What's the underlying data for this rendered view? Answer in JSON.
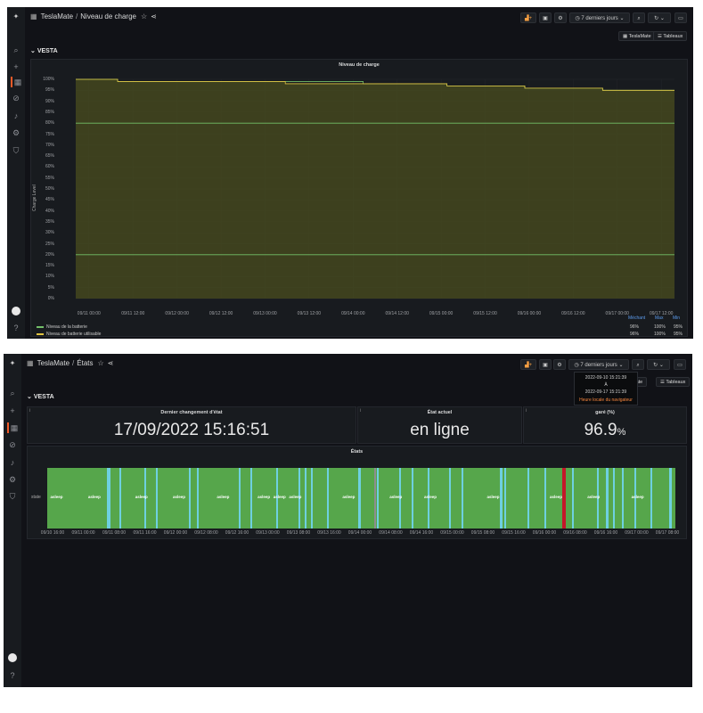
{
  "top": {
    "breadcrumb": {
      "app": "TeslaMate",
      "separator": "/",
      "page": "Niveau de charge"
    },
    "time_range": "7 derniers jours",
    "links": [
      "TeslaMate",
      "Tableaux"
    ],
    "row_title": "VESTA",
    "panel_title": "Niveau de charge",
    "chart_data": {
      "type": "line",
      "title": "Niveau de charge",
      "ylabel": "Charge Level",
      "ylim": [
        0,
        100
      ],
      "y_ticks": [
        "0%",
        "5%",
        "10%",
        "15%",
        "20%",
        "25%",
        "30%",
        "35%",
        "40%",
        "45%",
        "50%",
        "55%",
        "60%",
        "65%",
        "70%",
        "75%",
        "80%",
        "85%",
        "90%",
        "95%",
        "100%"
      ],
      "x_ticks": [
        "09/11 00:00",
        "09/11 12:00",
        "09/12 00:00",
        "09/12 12:00",
        "09/13 00:00",
        "09/13 12:00",
        "09/14 00:00",
        "09/14 12:00",
        "09/15 00:00",
        "09/15 12:00",
        "09/16 00:00",
        "09/16 12:00",
        "09/17 00:00",
        "09/17 12:00"
      ],
      "threshold_lines": [
        80,
        20
      ],
      "series": [
        {
          "name": "Niveau de la batterie",
          "color": "#73bf69",
          "steps": [
            [
              0.0,
              100
            ],
            [
              0.07,
              99
            ],
            [
              0.35,
              99
            ],
            [
              0.48,
              98
            ],
            [
              0.62,
              97
            ],
            [
              0.75,
              96
            ],
            [
              0.88,
              95
            ],
            [
              1.0,
              95
            ]
          ]
        },
        {
          "name": "Niveau de batterie utilisable",
          "color": "#e0c341",
          "steps": [
            [
              0.0,
              100
            ],
            [
              0.07,
              99
            ],
            [
              0.35,
              98
            ],
            [
              0.48,
              98
            ],
            [
              0.62,
              97
            ],
            [
              0.75,
              96
            ],
            [
              0.88,
              95
            ],
            [
              1.0,
              95
            ]
          ]
        }
      ],
      "legend": {
        "headers": [
          "Méchant",
          "Max",
          "Min"
        ],
        "rows": [
          {
            "name": "Niveau de la batterie",
            "values": [
              "96%",
              "100%",
              "95%"
            ]
          },
          {
            "name": "Niveau de batterie utilisable",
            "values": [
              "96%",
              "100%",
              "95%"
            ]
          }
        ]
      }
    }
  },
  "bottom": {
    "breadcrumb": {
      "app": "TeslaMate",
      "separator": "/",
      "page": "États"
    },
    "time_range": "7 derniers jours",
    "links": [
      "TeslaMate",
      "Tableaux"
    ],
    "links_partial": "Mate",
    "row_title": "VESTA",
    "tooltip": {
      "from": "2022-09-10 15:21:39",
      "to_word": "À",
      "to": "2022-09-17 15:21:39",
      "note": "Heure locale du navigateur"
    },
    "stats": [
      {
        "title": "Dernier changement d'état",
        "value": "17/09/2022 15:16:51",
        "unit": ""
      },
      {
        "title": "État actuel",
        "value": "en ligne",
        "unit": ""
      },
      {
        "title": "garé (%)",
        "value": "96.9",
        "unit": "%"
      }
    ],
    "states_panel_title": "États",
    "chart_data": {
      "type": "heatmap",
      "title": "États",
      "row_label": "state",
      "colors": {
        "asleep": "#56a64b",
        "online": "#6ed0e0",
        "charging": "#c4162a",
        "offline": "#8e8e8e"
      },
      "x_ticks": [
        "09/10 16:00",
        "09/11 00:00",
        "09/11 08:00",
        "09/11 16:00",
        "09/12 00:00",
        "09/12 08:00",
        "09/12 16:00",
        "09/13 00:00",
        "09/13 08:00",
        "09/13 16:00",
        "09/14 00:00",
        "09/14 08:00",
        "09/14 16:00",
        "09/15 00:00",
        "09/15 08:00",
        "09/15 16:00",
        "09/16 00:00",
        "09/16 08:00",
        "09/16 16:00",
        "09/17 00:00",
        "09/17 08:00"
      ],
      "label_text": "asleep",
      "marks": [
        {
          "x": 0.095,
          "w": 0.006,
          "state": "online"
        },
        {
          "x": 0.097,
          "w": 0.004,
          "state": "online"
        },
        {
          "x": 0.115,
          "w": 0.003,
          "state": "online"
        },
        {
          "x": 0.155,
          "w": 0.003,
          "state": "online"
        },
        {
          "x": 0.173,
          "w": 0.003,
          "state": "online"
        },
        {
          "x": 0.225,
          "w": 0.003,
          "state": "online"
        },
        {
          "x": 0.238,
          "w": 0.003,
          "state": "online"
        },
        {
          "x": 0.305,
          "w": 0.003,
          "state": "online"
        },
        {
          "x": 0.323,
          "w": 0.003,
          "state": "online"
        },
        {
          "x": 0.365,
          "w": 0.003,
          "state": "online"
        },
        {
          "x": 0.4,
          "w": 0.003,
          "state": "online"
        },
        {
          "x": 0.41,
          "w": 0.003,
          "state": "online"
        },
        {
          "x": 0.42,
          "w": 0.003,
          "state": "online"
        },
        {
          "x": 0.445,
          "w": 0.003,
          "state": "online"
        },
        {
          "x": 0.495,
          "w": 0.004,
          "state": "online"
        },
        {
          "x": 0.52,
          "w": 0.003,
          "state": "offline"
        },
        {
          "x": 0.525,
          "w": 0.003,
          "state": "online"
        },
        {
          "x": 0.56,
          "w": 0.003,
          "state": "online"
        },
        {
          "x": 0.58,
          "w": 0.003,
          "state": "online"
        },
        {
          "x": 0.605,
          "w": 0.003,
          "state": "online"
        },
        {
          "x": 0.64,
          "w": 0.003,
          "state": "online"
        },
        {
          "x": 0.66,
          "w": 0.003,
          "state": "online"
        },
        {
          "x": 0.72,
          "w": 0.005,
          "state": "online"
        },
        {
          "x": 0.728,
          "w": 0.003,
          "state": "online"
        },
        {
          "x": 0.765,
          "w": 0.003,
          "state": "online"
        },
        {
          "x": 0.792,
          "w": 0.003,
          "state": "online"
        },
        {
          "x": 0.82,
          "w": 0.006,
          "state": "charging"
        },
        {
          "x": 0.835,
          "w": 0.003,
          "state": "online"
        },
        {
          "x": 0.875,
          "w": 0.003,
          "state": "online"
        },
        {
          "x": 0.89,
          "w": 0.003,
          "state": "online"
        },
        {
          "x": 0.9,
          "w": 0.003,
          "state": "online"
        },
        {
          "x": 0.915,
          "w": 0.003,
          "state": "online"
        },
        {
          "x": 0.935,
          "w": 0.003,
          "state": "online"
        },
        {
          "x": 0.96,
          "w": 0.003,
          "state": "online"
        },
        {
          "x": 0.99,
          "w": 0.004,
          "state": "online"
        }
      ],
      "labels_at": [
        0.005,
        0.065,
        0.14,
        0.2,
        0.27,
        0.335,
        0.36,
        0.385,
        0.47,
        0.545,
        0.6,
        0.7,
        0.8,
        0.86,
        0.93
      ]
    }
  }
}
